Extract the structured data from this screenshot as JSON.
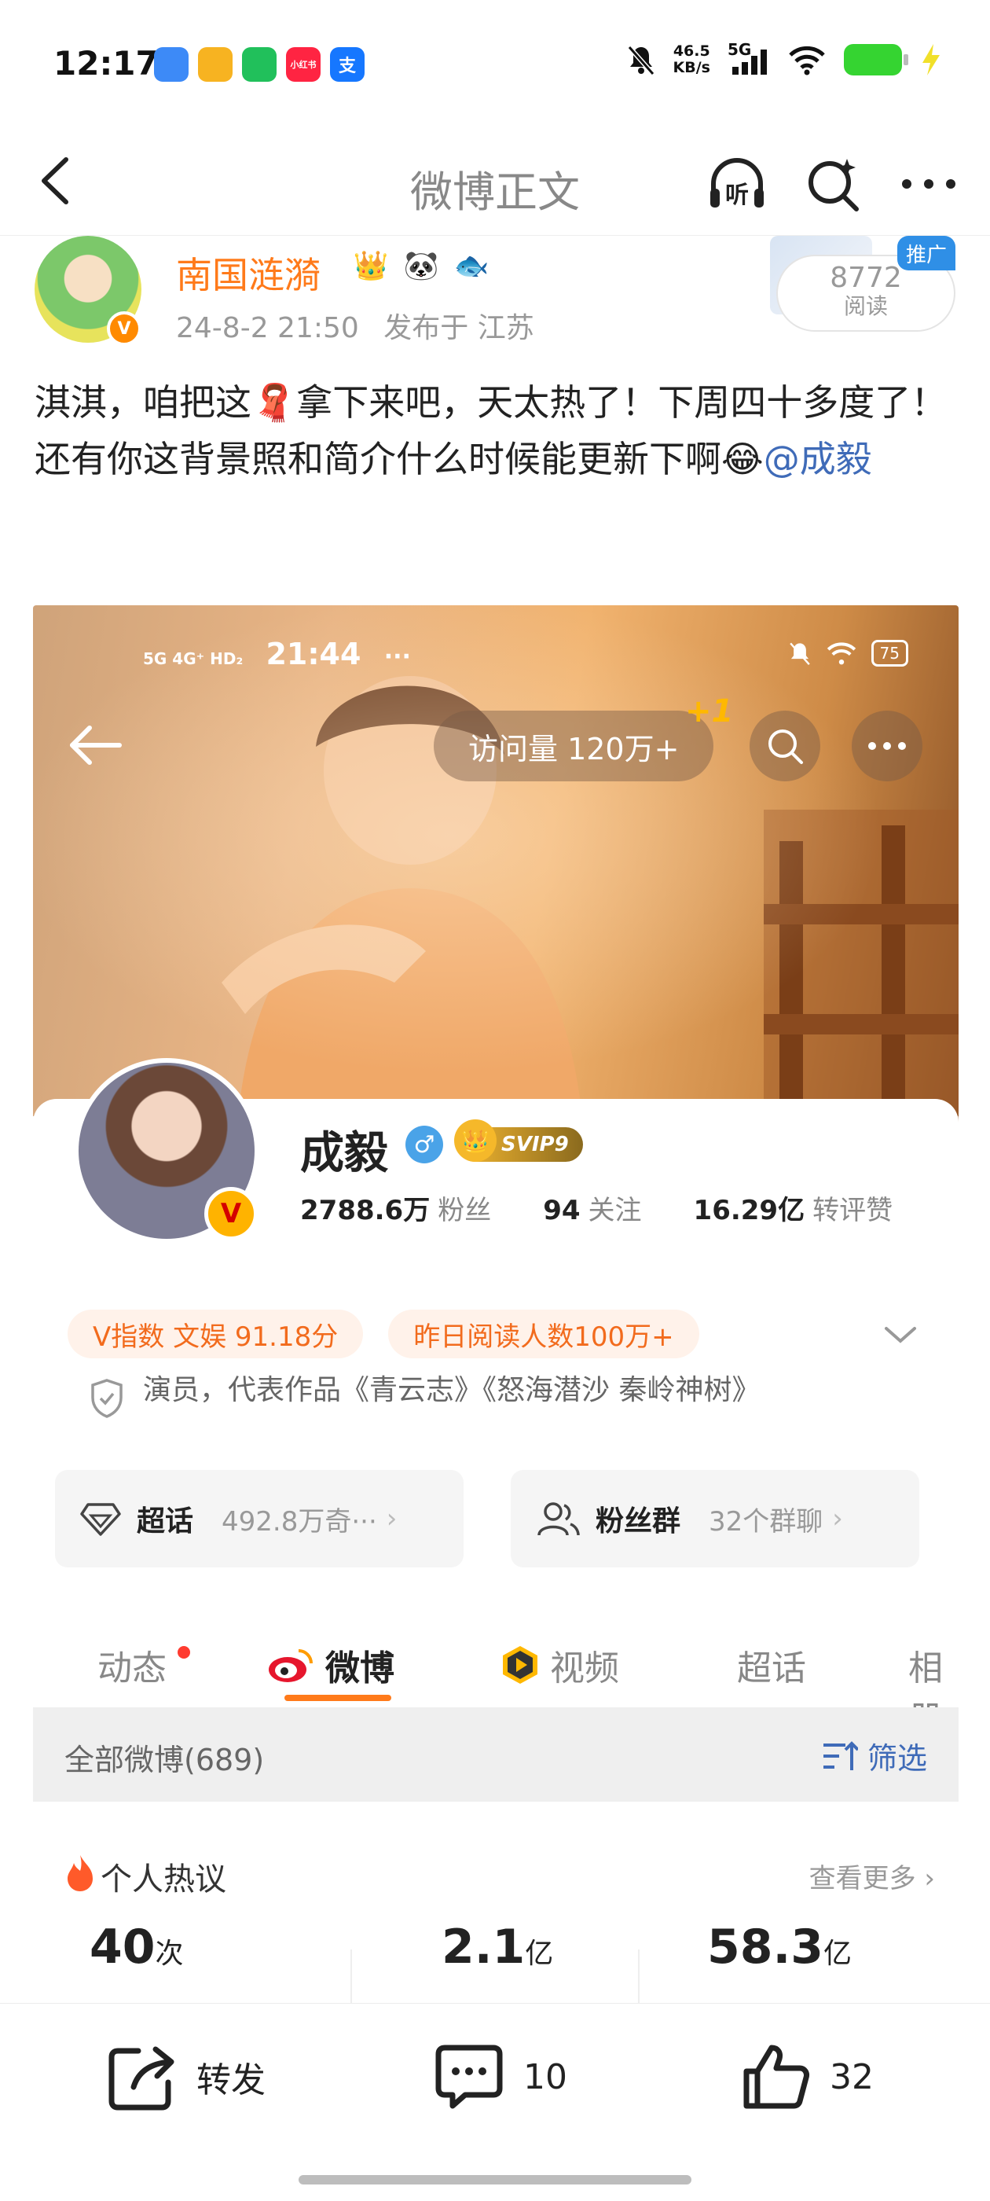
{
  "status_bar": {
    "time": "12:17",
    "net_speed_value": "46.5",
    "net_speed_unit": "KB/s",
    "signal_label": "5G",
    "apps": [
      {
        "name": "blue-app",
        "glyph": "",
        "color": "#3d8af7"
      },
      {
        "name": "weibo-app",
        "glyph": "",
        "color": "#f7b321"
      },
      {
        "name": "wechat-app",
        "glyph": "",
        "color": "#21c05b"
      },
      {
        "name": "xiaohongshu-app",
        "glyph": "小红书",
        "color": "#ff2442"
      },
      {
        "name": "alipay-app",
        "glyph": "支",
        "color": "#1677ff"
      }
    ]
  },
  "nav": {
    "title": "微博正文",
    "listen_label": "听"
  },
  "author": {
    "name": "南国涟漪",
    "date": "24-8-2 21:50",
    "location": "发布于 江苏",
    "badges": [
      "👑",
      "🐼",
      "🐟"
    ],
    "read_count": "8772",
    "read_label": "阅读",
    "promo_tag": "推广"
  },
  "post": {
    "text": "淇淇，咱把这🧣拿下来吧，天太热了！下周四十多度了！\n还有你这背景照和简介什么时候能更新下啊😂",
    "mention": "@成毅"
  },
  "screenshot": {
    "status_time": "21:44",
    "status_left": "5G  4G⁺  HD₂",
    "battery": "75",
    "visits": "访问量 120万+",
    "plus_one": "+1",
    "profile": {
      "name": "成毅",
      "svip": "SVIP9",
      "followers_num": "2788.6万",
      "followers_label": "粉丝",
      "following_num": "94",
      "following_label": "关注",
      "reposts_num": "16.29亿",
      "reposts_label": "转评赞",
      "tags": [
        "V指数 文娱 91.18分",
        "昨日阅读人数100万+"
      ],
      "bio": "演员，代表作品《青云志》《怒海潜沙 秦岭神树》",
      "supertopic_title": "超话",
      "supertopic_sub": "492.8万奇···",
      "fans_title": "粉丝群",
      "fans_sub": "32个群聊"
    },
    "tabs": [
      "动态",
      "微博",
      "视频",
      "超话",
      "相册"
    ],
    "all_weibo": "全部微博(689)",
    "filter": "筛选",
    "hot": {
      "title": "个人热议",
      "more": "查看更多",
      "stats": [
        {
          "value": "40",
          "unit": "次"
        },
        {
          "value": "2.1",
          "unit": "亿"
        },
        {
          "value": "58.3",
          "unit": "亿"
        }
      ]
    }
  },
  "actions": {
    "repost": "转发",
    "comment_count": "10",
    "like_count": "32"
  }
}
